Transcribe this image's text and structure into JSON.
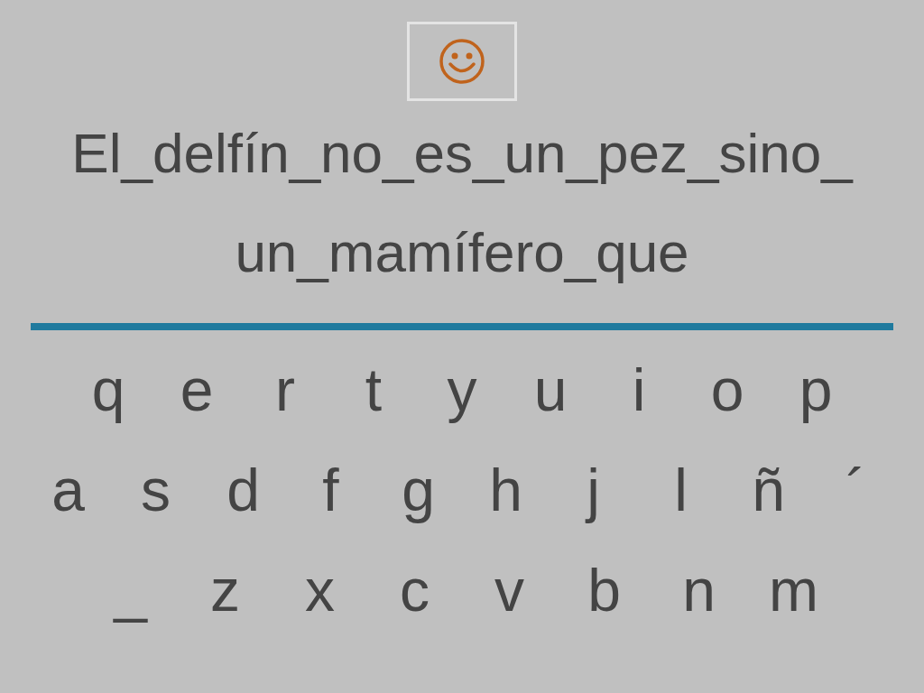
{
  "sentence_lines": [
    "El_delfín_no_es_un_pez_sino_",
    "un_mamífero_que"
  ],
  "keyboard_rows": [
    [
      "q",
      "e",
      "r",
      "t",
      "y",
      "u",
      "i",
      "o",
      "p"
    ],
    [
      "a",
      "s",
      "d",
      "f",
      "g",
      "h",
      "j",
      "l",
      "ñ",
      "´"
    ],
    [
      "_",
      "z",
      "x",
      "c",
      "v",
      "b",
      "n",
      "m"
    ]
  ]
}
